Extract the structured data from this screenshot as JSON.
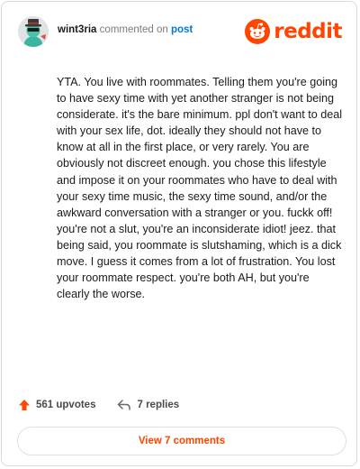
{
  "header": {
    "username": "wint3ria",
    "action_text": "commented on",
    "post_link": "post",
    "brand": "reddit"
  },
  "comment": {
    "text": "YTA. You live with roommates. Telling them you're going to have sexy time with yet another stranger is not being considerate. it's the bare minimum. ppl don't want to deal with your sex life, dot. ideally they should not have to know at all in the first place, or very rarely. You are obviously not discreet enough. you chose this lifestyle and impose it on your roommates who have to deal with your sexy time music, the sexy time sound, and/or the awkward conversation with a stranger or you. fuckk off! you're not a slut, you're an inconsiderate idiot! jeez. that being said, you roommate is slutshaming, which is a dick move. I guess it comes from a lot of frustration. You lost your roommate respect. you're both AH, but you're clearly the worse."
  },
  "actions": {
    "upvotes": "561 upvotes",
    "replies": "7 replies"
  },
  "view_button": "View 7 comments",
  "colors": {
    "brand": "#ff4500",
    "link": "#0079d3",
    "text": "#1a1a1b",
    "muted": "#7c7c7c"
  },
  "icons": [
    "avatar",
    "reddit-snoo-icon",
    "upvote-arrow-icon",
    "reply-arrow-icon"
  ]
}
